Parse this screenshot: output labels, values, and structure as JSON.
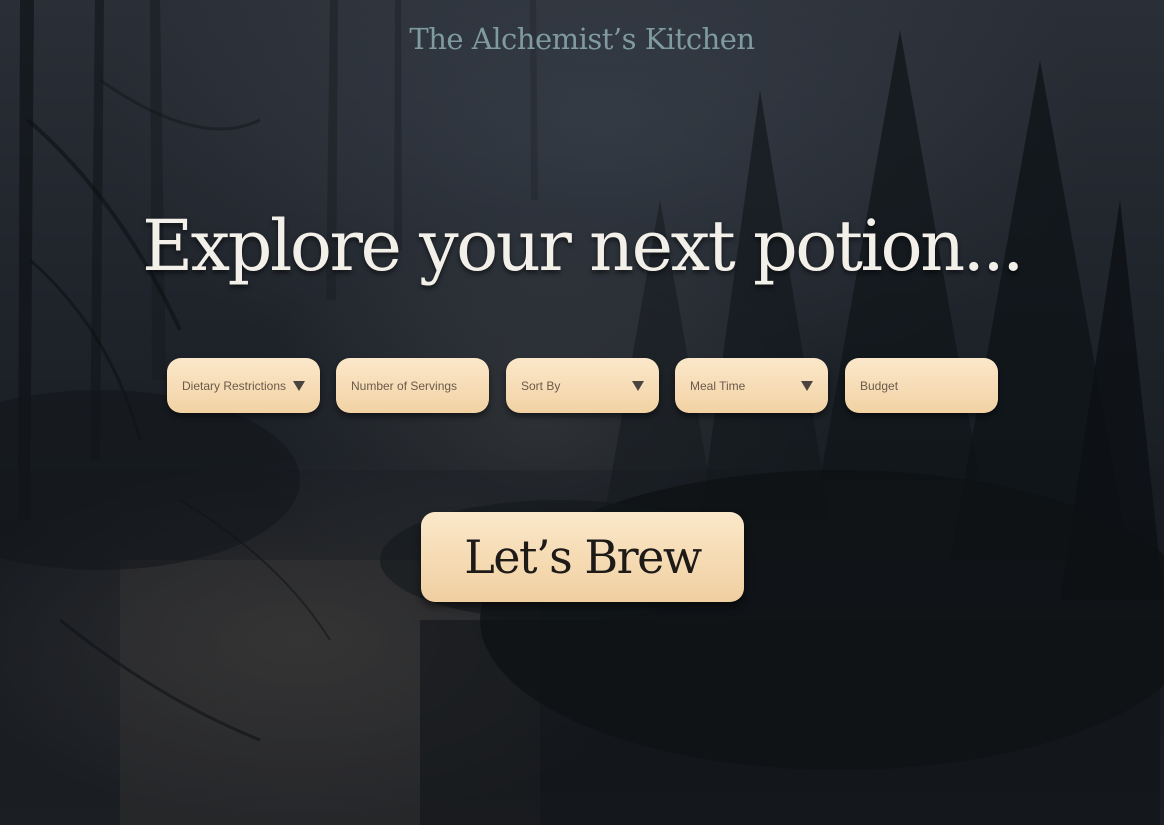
{
  "brand": {
    "title": "The Alchemist’s Kitchen"
  },
  "hero": {
    "headline": "Explore your next potion..."
  },
  "filters": [
    {
      "label": "Dietary Restrictions",
      "type": "dropdown",
      "icon": "caret-down-icon"
    },
    {
      "label": "Number of Servings",
      "type": "input"
    },
    {
      "label": "Sort By",
      "type": "dropdown",
      "icon": "caret-down-icon"
    },
    {
      "label": "Meal Time",
      "type": "dropdown",
      "icon": "caret-down-icon"
    },
    {
      "label": "Budget",
      "type": "input"
    }
  ],
  "cta": {
    "label": "Let’s Brew"
  },
  "colors": {
    "brand_text": "#7f9aa0",
    "headline_text": "#f3f0ea",
    "control_fill_top": "#fbe8ca",
    "control_fill_bottom": "#f2d2a4",
    "control_text": "#6a5a4a",
    "cta_text": "#1d1a17"
  }
}
